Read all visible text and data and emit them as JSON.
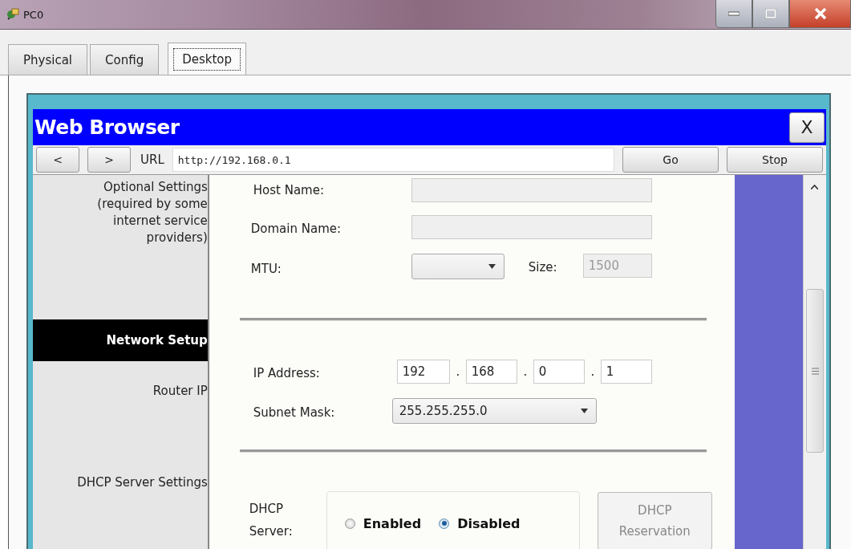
{
  "window": {
    "title": "PC0"
  },
  "tabs": [
    {
      "label": "Physical",
      "selected": false
    },
    {
      "label": "Config",
      "selected": false
    },
    {
      "label": "Desktop",
      "selected": true
    }
  ],
  "browser": {
    "title": "Web Browser",
    "close": "X",
    "back": "<",
    "forward": ">",
    "url_label": "URL",
    "url": "http://192.168.0.1",
    "go": "Go",
    "stop": "Stop"
  },
  "sidebar": [
    {
      "kind": "label",
      "label": "Optional Settings (required by some internet service providers)"
    },
    {
      "kind": "header",
      "label": "Network Setup"
    },
    {
      "kind": "label",
      "label": "Router IP"
    },
    {
      "kind": "label",
      "label": "DHCP Server Settings"
    }
  ],
  "optional": {
    "host_name": {
      "label": "Host Name:",
      "disabled": true
    },
    "domain_name": {
      "label": "Domain Name:",
      "disabled": true
    },
    "mtu": {
      "label": "MTU:",
      "size_label": "Size:",
      "size": "1500",
      "size_disabled": true
    }
  },
  "router_ip": {
    "ip_label": "IP Address:",
    "octets": [
      "192",
      "168",
      "0",
      "1"
    ],
    "separator": ".",
    "mask_label": "Subnet Mask:",
    "mask": "255.255.255.0"
  },
  "dhcp": {
    "label": "DHCP Server:",
    "options": [
      {
        "label": "Enabled",
        "selected": false
      },
      {
        "label": "Disabled",
        "selected": true
      }
    ],
    "reservation": {
      "label": "DHCP Reservation",
      "disabled": true
    }
  }
}
